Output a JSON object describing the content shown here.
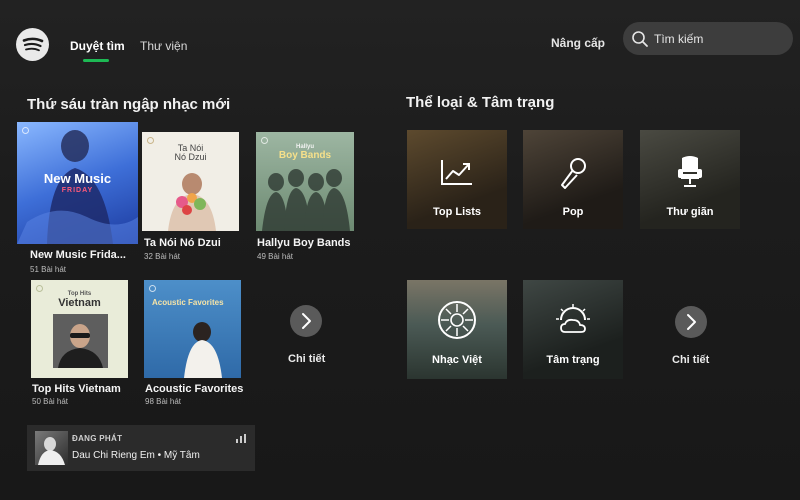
{
  "nav": {
    "tabs": [
      {
        "label": "Duyệt tìm",
        "active": true
      },
      {
        "label": "Thư viện",
        "active": false
      }
    ],
    "upgrade_label": "Nâng cấp",
    "search_placeholder": "Tìm kiếm",
    "accent_color": "#1db954",
    "logo_icon": "spotify-logo-icon",
    "search_icon": "search-icon"
  },
  "new_music": {
    "title": "Thứ sáu tràn ngập nhạc mới",
    "playlists": [
      {
        "title": "New Music Frida...",
        "count": "51 Bài hát",
        "cover_text": "New Music",
        "cover_sub": "FRIDAY"
      },
      {
        "title": "Ta Nói Nó Dzui",
        "count": "32 Bài hát",
        "cover_text": "Ta Nói\nNó Dzui"
      },
      {
        "title": "Hallyu Boy Bands",
        "count": "49 Bài hát",
        "cover_top": "Hallyu",
        "cover_text": "Boy Bands"
      },
      {
        "title": "Top Hits Vietnam",
        "count": "50 Bài hát",
        "cover_top": "Top Hits",
        "cover_text": "Vietnam"
      },
      {
        "title": "Acoustic Favorites",
        "count": "98 Bài hát",
        "cover_text": "Acoustic Favorites"
      }
    ],
    "more_label": "Chi tiết",
    "more_icon": "chevron-right-icon"
  },
  "genres": {
    "title": "Thể loại & Tâm trạng",
    "tiles": [
      {
        "label": "Top Lists",
        "icon": "trending-chart-icon"
      },
      {
        "label": "Pop",
        "icon": "microphone-icon"
      },
      {
        "label": "Thư giãn",
        "icon": "armchair-icon"
      },
      {
        "label": "Nhạc Việt",
        "icon": "lotus-emblem-icon"
      },
      {
        "label": "Tâm trạng",
        "icon": "weather-sun-cloud-icon"
      }
    ],
    "more_label": "Chi tiết",
    "more_icon": "chevron-right-icon"
  },
  "now_playing": {
    "status": "ĐANG PHÁT",
    "track": "Dau Chi Rieng Em • Mỹ Tâm",
    "device_icon": "equalizer-bars-icon"
  }
}
